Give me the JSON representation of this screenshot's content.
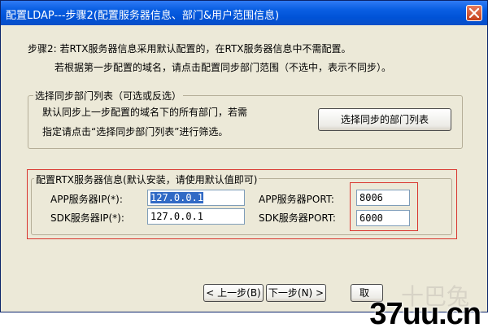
{
  "window": {
    "title": "配置LDAP---步骤2(配置服务器信息、部门&用户范围信息)"
  },
  "intro": {
    "line1": "步骤2: 若RTX服务器信息采用默认配置的，在RTX服务器信息中不需配置。",
    "line2": "若根据第一步配置的域名，请点击配置同步部门范围（不选中，表示不同步）。"
  },
  "dept_group": {
    "label": "选择同步部门列表（可选或反选）",
    "desc_line1": "默认同步上一步配置的域名下的所有部门，若需",
    "desc_line2": "指定请点击“选择同步部门列表”进行筛选。",
    "button_label": "选择同步的部门列表"
  },
  "server_group": {
    "label": "配置RTX服务器信息(默认安装，请使用默认值即可)",
    "app_ip_label": "APP服务器IP(*):",
    "app_ip_value": "127.0.0.1",
    "sdk_ip_label": "SDK服务器IP(*):",
    "sdk_ip_value": "127.0.0.1",
    "app_port_label": "APP服务器PORT:",
    "app_port_value": "8006",
    "sdk_port_label": "SDK服务器PORT:",
    "sdk_port_value": "6000"
  },
  "nav": {
    "back_label": "< 上一步(B)",
    "next_label": "下一步(N) >",
    "cancel_partial": "取"
  },
  "watermark": {
    "text": "37uu.cn",
    "faint": "十巴兔"
  },
  "colors": {
    "titlebar": "#0a5fe3",
    "highlight_box": "#d9352e",
    "selection": "#316ac5"
  }
}
